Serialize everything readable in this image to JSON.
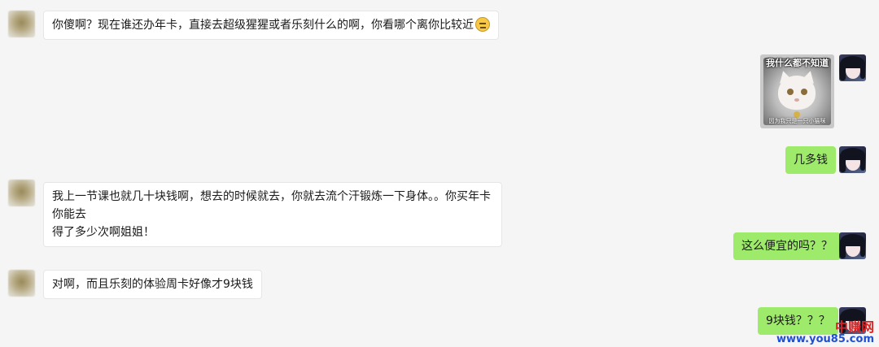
{
  "messages": [
    {
      "side": "left",
      "type": "text",
      "text": "你傻啊？现在谁还办年卡，直接去超级猩猩或者乐刻什么的啊，你看哪个离你比较近",
      "emoji": "unamused-emoji"
    },
    {
      "side": "right",
      "type": "sticker",
      "top_text": "我什么都不知道",
      "bottom_text": "因为我只是一只小猫咪"
    },
    {
      "side": "right",
      "type": "text",
      "text": "几多钱"
    },
    {
      "side": "left",
      "type": "text",
      "lines": [
        "我上一节课也就几十块钱啊，想去的时候就去，你就去流个汗锻炼一下身体。。你买年卡你能去",
        "得了多少次啊姐姐！"
      ]
    },
    {
      "side": "right",
      "type": "text",
      "text": "这么便宜的吗？？"
    },
    {
      "side": "left",
      "type": "text",
      "text": "对啊，而且乐刻的体验周卡好像才9块钱"
    },
    {
      "side": "right",
      "type": "text",
      "text": "9块钱？？？"
    }
  ],
  "watermark": {
    "name": "中赚网",
    "url": "www.you85.com"
  },
  "colors": {
    "background": "#f5f5f5",
    "left_bubble": "#ffffff",
    "right_bubble": "#9eea6a",
    "watermark_name": "#e02020",
    "watermark_url": "#1e4fd6"
  }
}
